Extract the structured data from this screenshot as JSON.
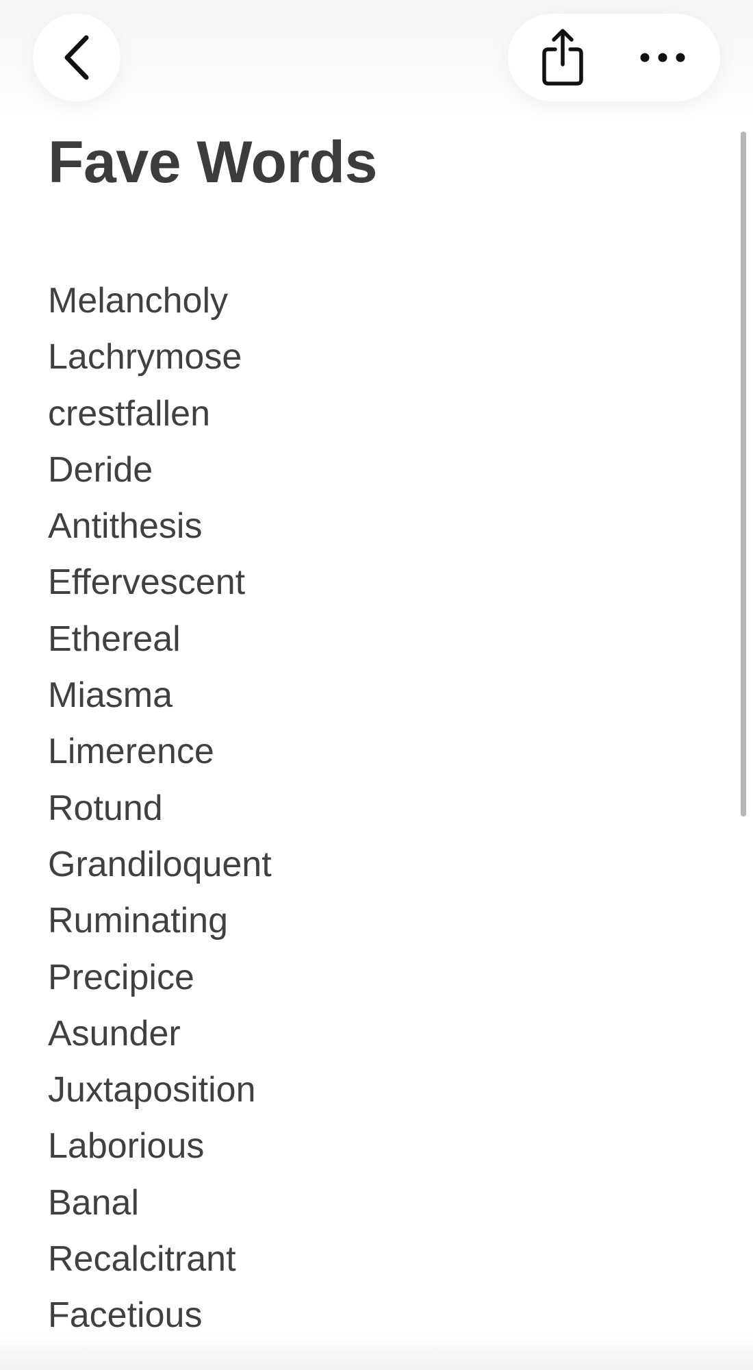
{
  "navbar": {
    "back_icon": "chevron-left-icon",
    "share_icon": "share-icon",
    "more_icon": "ellipsis-icon"
  },
  "note": {
    "title": "Fave Words",
    "words": [
      "Melancholy",
      "Lachrymose",
      "crestfallen",
      "Deride",
      "Antithesis",
      "Effervescent",
      "Ethereal",
      "Miasma",
      "Limerence",
      "Rotund",
      "Grandiloquent",
      "Ruminating",
      "Precipice",
      "Asunder",
      "Juxtaposition",
      "Laborious",
      "Banal",
      "Recalcitrant",
      "Facetious"
    ]
  },
  "colors": {
    "text": "#404040",
    "background": "#ffffff",
    "button_bg": "#ffffff"
  }
}
